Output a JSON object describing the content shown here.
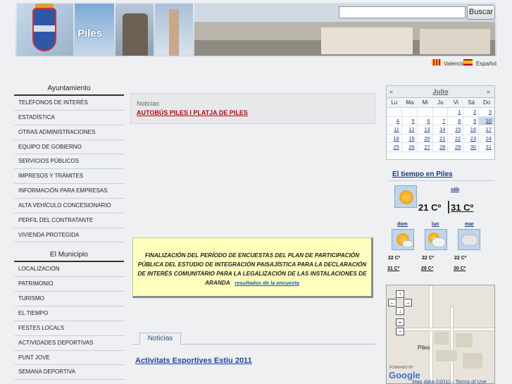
{
  "header": {
    "banner_text": "Piles",
    "search_placeholder": "",
    "search_button": "Buscar"
  },
  "languages": [
    "Valencià",
    "Español"
  ],
  "sidebar": {
    "section1_title": "Ayuntamiento",
    "section1_items": [
      "Teléfonos de interés",
      "Estadística",
      "Otras administraciones",
      "Equipo de gobierno",
      "Servicios públicos",
      "Impresos y trámites",
      "Información para empresas",
      "Alta vehículo concesionario",
      "Perfil del contratante",
      "Vivienda protegida"
    ],
    "section2_title": "El Municipio",
    "section2_items": [
      "Localización",
      "Patrimonio",
      "Turismo",
      "El tiempo",
      "Festes locals",
      "Actividades deportivas",
      "Punt jove",
      "Semana deportiva"
    ]
  },
  "news": {
    "label": "Noticias",
    "link": "AUTOBÚS PILES I PLATJA DE PILES"
  },
  "notice": {
    "text": "FINALIZACIÓN DEL PERÍODO DE ENCUESTAS DEL PLAN DE PARTICIPACIÓN PÚBLICA DEL ESTUDIO DE INTEGRACIÓN PAISAJÍSTICA PARA LA DECLARACIÓN DE INTERÉS COMUNITARIO PARA LA LEGALIZACIÓN DE LAS INSTALACIONES DE ARANDA",
    "link": "resultados de la encuesta"
  },
  "tabs": {
    "noticias": "Noticias"
  },
  "article": {
    "title": "Activitats Esportives Estiu 2011"
  },
  "calendar": {
    "prev": "«",
    "next": "»",
    "month": "Julio",
    "dow": [
      "Lu",
      "Ma",
      "Mi",
      "Ju",
      "Vi",
      "Sá",
      "Do"
    ],
    "days": [
      "",
      "",
      "",
      "",
      "1",
      "2",
      "3",
      "4",
      "5",
      "6",
      "7",
      "8",
      "9",
      "10",
      "11",
      "12",
      "13",
      "14",
      "15",
      "16",
      "17",
      "18",
      "19",
      "20",
      "21",
      "22",
      "23",
      "24",
      "25",
      "26",
      "27",
      "28",
      "29",
      "30",
      "31"
    ],
    "highlighted": "10"
  },
  "weather": {
    "title": "El tiempo en Piles",
    "today_day": "sáb",
    "today_temp": "21 Cº",
    "today_temp2": "31 Cº",
    "days": [
      "dom",
      "lun",
      "mar"
    ],
    "low": [
      "22 Cº",
      "22 Cº",
      "22 Cº"
    ],
    "high": [
      "31 Cº",
      "29 Cº",
      "30 Cº"
    ]
  },
  "map": {
    "controls": [
      "↑",
      "←",
      "→",
      "↓",
      "+",
      "−"
    ],
    "label": "Piles",
    "powered_by": "POWERED BY",
    "logo": "Google",
    "data": "Map data ©2011",
    "dash": "-",
    "terms": "Terms of Use"
  }
}
